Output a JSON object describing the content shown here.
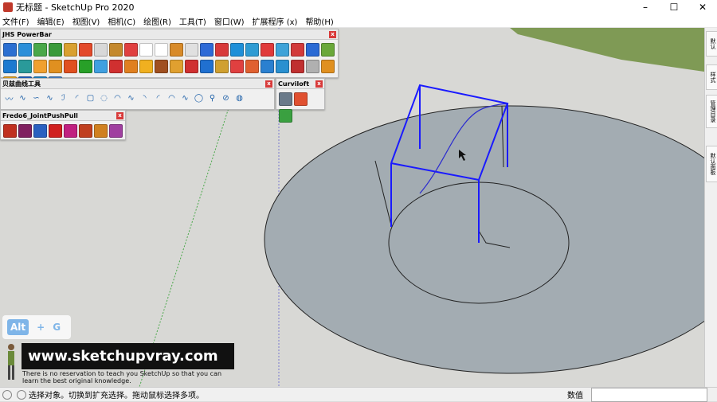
{
  "window": {
    "title": "无标题 - SketchUp Pro 2020",
    "minimize": "–",
    "maximize": "☐",
    "close": "✕"
  },
  "menu": [
    "文件(F)",
    "编辑(E)",
    "视图(V)",
    "相机(C)",
    "绘图(R)",
    "工具(T)",
    "窗口(W)",
    "扩展程序 (x)",
    "帮助(H)"
  ],
  "toolbars": {
    "jhs": {
      "title": "JHS PowerBar",
      "row1": [
        "#2b6fd1",
        "#2b8fd9",
        "#4aa84a",
        "#3a9a3a",
        "#d9a030",
        "#e34a2a",
        "#d8d8d8",
        "#c4882c",
        "#e04040",
        "#ffffff",
        "#ffffff",
        "#d88b2a",
        "#e0e0e0",
        "#2e6ad6",
        "#d83a3a",
        "#1e8fd8",
        "#2e9bd3",
        "#e03a3a",
        "#3fa3d8",
        "#d23a3a",
        "#2a6ad4",
        "#6aa83a",
        "#1c7ad0",
        "#2a9a9a"
      ],
      "row2": [
        "#f0a030",
        "#e09020",
        "#e05020",
        "#28a028",
        "#40a0e0",
        "#d03030",
        "#e08020",
        "#f0b020",
        "#a05020",
        "#e0a030",
        "#d03030",
        "#2070d0",
        "#d0a030",
        "#e04040",
        "#e06030",
        "#2a80d0",
        "#2a90d0",
        "#c03030",
        "#b0b0b0",
        "#e09020",
        "#e0a020",
        "#2060c0",
        "#2080c0",
        "#4a80c0"
      ]
    },
    "bezier": {
      "title": "贝兹曲线工具",
      "glyphs": [
        "〰",
        "∿",
        "∽",
        "∿",
        "ℐ",
        "◜",
        "▢",
        "◌",
        "◠",
        "∿",
        "◝",
        "◜",
        "◠",
        "∿",
        "◯",
        "⚲",
        "⊘",
        "◍"
      ]
    },
    "curviloft": {
      "title": "Curviloft",
      "icons": [
        "#6a7a8a",
        "#e05030",
        "#3aa040"
      ]
    },
    "fredo": {
      "title": "Fredo6_JointPushPull",
      "icons": [
        "#c03020",
        "#802060",
        "#2a60c0",
        "#d02020",
        "#c02080",
        "#c04020",
        "#d08020",
        "#a040a0"
      ]
    }
  },
  "right_tabs": [
    "默认",
    "样式",
    "管理目录",
    "默认面板"
  ],
  "overlay": {
    "key_alt": "Alt",
    "key_plus": "+",
    "key_g": "G",
    "site": "www.sketchupvray.com",
    "tagline": "There is no reservation to teach you SketchUp so that you can learn the best original knowledge."
  },
  "status": {
    "message": "选择对象。切换到扩充选择。拖动鼠标选择多项。",
    "measure_label": "数值",
    "measure_value": ""
  }
}
